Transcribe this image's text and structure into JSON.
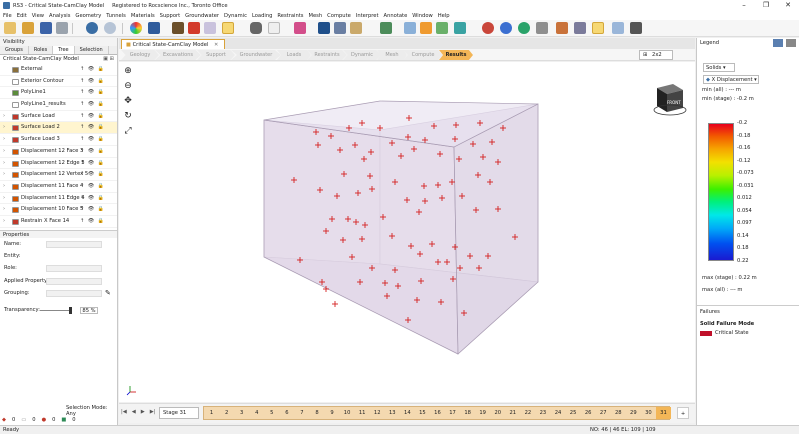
{
  "title": "RS3 - Critical State-CamClay Model",
  "title_extra": "Registered to Rocscience Inc., Toronto Office",
  "window_controls": [
    "–",
    "❐",
    "✕"
  ],
  "menu": [
    "File",
    "Edit",
    "View",
    "Analysis",
    "Geometry",
    "Tunnels",
    "Materials",
    "Support",
    "Groundwater",
    "Dynamic",
    "Loading",
    "Restraints",
    "Mesh",
    "Compute",
    "Interpret",
    "Annotate",
    "Window",
    "Help"
  ],
  "left": {
    "visibility_title": "Visibility",
    "tabs": [
      "Groups",
      "Roles",
      "Tree",
      "Selection"
    ],
    "active_tab": "Tree",
    "tree_root": "Critical State-CamClay Model",
    "tree": [
      {
        "label": "External",
        "color": "#8a6f3a"
      },
      {
        "label": "Exterior Contour",
        "color": "#ffffff"
      },
      {
        "label": "PolyLine1",
        "color": "#5b8c3b"
      },
      {
        "label": "PolyLine1_results",
        "color": "#ffffff"
      },
      {
        "label": "Surface Load",
        "color": "#c0392b"
      },
      {
        "label": "Surface Load 2",
        "color": "#c0392b"
      },
      {
        "label": "Surface Load 3",
        "color": "#c0392b"
      },
      {
        "label": "Displacement 12 Face 3",
        "color": "#d35400"
      },
      {
        "label": "Displacement 12 Edge 3",
        "color": "#d35400"
      },
      {
        "label": "Displacement 12 Vertex 5",
        "color": "#d35400"
      },
      {
        "label": "Displacement 11 Face 4",
        "color": "#d35400"
      },
      {
        "label": "Displacement 11 Edge 4",
        "color": "#d35400"
      },
      {
        "label": "Displacement 10 Face 5",
        "color": "#d35400"
      },
      {
        "label": "Restrain X Face 14",
        "color": "#c0392b"
      }
    ],
    "tree_row_icons": "↑ 👁 🔒",
    "properties_title": "Properties",
    "props": [
      "Name:",
      "Entity:",
      "Role:",
      "Applied Property:",
      "Grouping:"
    ],
    "transparency_label": "Transparency:",
    "transparency_value": "85 %",
    "selection_mode": "Selection Mode: Any",
    "counters": [
      "0",
      "0",
      "0",
      "0"
    ]
  },
  "view_tab": "Critical State-CamClay Model",
  "workflow": [
    "Geology",
    "Excavations",
    "Support",
    "Groundwater",
    "Loads",
    "Restraints",
    "Dynamic",
    "Mesh",
    "Compute",
    "Results"
  ],
  "workflow_active": "Results",
  "layout_label": "2x2",
  "nav_icons": [
    "zoom-in-icon",
    "zoom-out-icon",
    "pan-icon",
    "rotate-icon",
    "fit-icon"
  ],
  "viewcube_label": "FRONT",
  "stage_label": "Stage 31",
  "stages": [
    "1",
    "2",
    "3",
    "4",
    "5",
    "6",
    "7",
    "8",
    "9",
    "10",
    "11",
    "12",
    "13",
    "14",
    "15",
    "16",
    "17",
    "18",
    "19",
    "20",
    "21",
    "22",
    "23",
    "24",
    "25",
    "26",
    "27",
    "28",
    "29",
    "30",
    "31"
  ],
  "legend": {
    "title": "Legend",
    "solids": "Solids",
    "result": "X Displacement",
    "min_all": "min (all) :     --- m",
    "min_stage": "min (stage) : -0.2 m",
    "ticks": [
      "-0.2",
      "-0.18",
      "-0.16",
      "-0.12",
      "-0.073",
      "-0.031",
      "0.012",
      "0.054",
      "0.097",
      "0.14",
      "0.18",
      "0.22"
    ],
    "max_stage": "max (stage) : 0.22 m",
    "max_all": "max (all) :     --- m",
    "failures_title": "Failures",
    "failure_mode": "Solid Failure Mode",
    "failure_item": "Critical State",
    "failure_color": "#c0102a"
  },
  "status": {
    "ready": "Ready",
    "right": "NO: 46 | 46  EL: 109 | 109"
  },
  "points": [
    [
      316,
      132
    ],
    [
      331,
      136
    ],
    [
      318,
      145
    ],
    [
      349,
      128
    ],
    [
      362,
      123
    ],
    [
      380,
      128
    ],
    [
      409,
      118
    ],
    [
      434,
      126
    ],
    [
      456,
      125
    ],
    [
      480,
      123
    ],
    [
      503,
      128
    ],
    [
      355,
      145
    ],
    [
      371,
      152
    ],
    [
      392,
      143
    ],
    [
      408,
      137
    ],
    [
      425,
      140
    ],
    [
      455,
      139
    ],
    [
      473,
      144
    ],
    [
      492,
      142
    ],
    [
      294,
      180
    ],
    [
      340,
      150
    ],
    [
      344,
      174
    ],
    [
      364,
      159
    ],
    [
      370,
      176
    ],
    [
      401,
      156
    ],
    [
      414,
      149
    ],
    [
      440,
      154
    ],
    [
      459,
      159
    ],
    [
      483,
      157
    ],
    [
      498,
      162
    ],
    [
      320,
      190
    ],
    [
      337,
      196
    ],
    [
      358,
      193
    ],
    [
      372,
      189
    ],
    [
      395,
      182
    ],
    [
      424,
      186
    ],
    [
      438,
      185
    ],
    [
      452,
      182
    ],
    [
      478,
      175
    ],
    [
      490,
      182
    ],
    [
      332,
      219
    ],
    [
      348,
      219
    ],
    [
      326,
      231
    ],
    [
      343,
      240
    ],
    [
      356,
      222
    ],
    [
      365,
      225
    ],
    [
      383,
      217
    ],
    [
      407,
      200
    ],
    [
      425,
      201
    ],
    [
      442,
      198
    ],
    [
      462,
      196
    ],
    [
      476,
      210
    ],
    [
      498,
      209
    ],
    [
      419,
      212
    ],
    [
      362,
      239
    ],
    [
      392,
      236
    ],
    [
      411,
      246
    ],
    [
      432,
      244
    ],
    [
      455,
      247
    ],
    [
      470,
      256
    ],
    [
      488,
      256
    ],
    [
      515,
      237
    ],
    [
      300,
      260
    ],
    [
      352,
      257
    ],
    [
      372,
      268
    ],
    [
      395,
      270
    ],
    [
      420,
      254
    ],
    [
      438,
      262
    ],
    [
      447,
      262
    ],
    [
      460,
      268
    ],
    [
      479,
      268
    ],
    [
      322,
      282
    ],
    [
      360,
      282
    ],
    [
      385,
      283
    ],
    [
      398,
      286
    ],
    [
      421,
      281
    ],
    [
      453,
      279
    ],
    [
      326,
      289
    ],
    [
      335,
      304
    ],
    [
      387,
      296
    ],
    [
      417,
      300
    ],
    [
      441,
      302
    ],
    [
      464,
      313
    ],
    [
      408,
      320
    ]
  ]
}
